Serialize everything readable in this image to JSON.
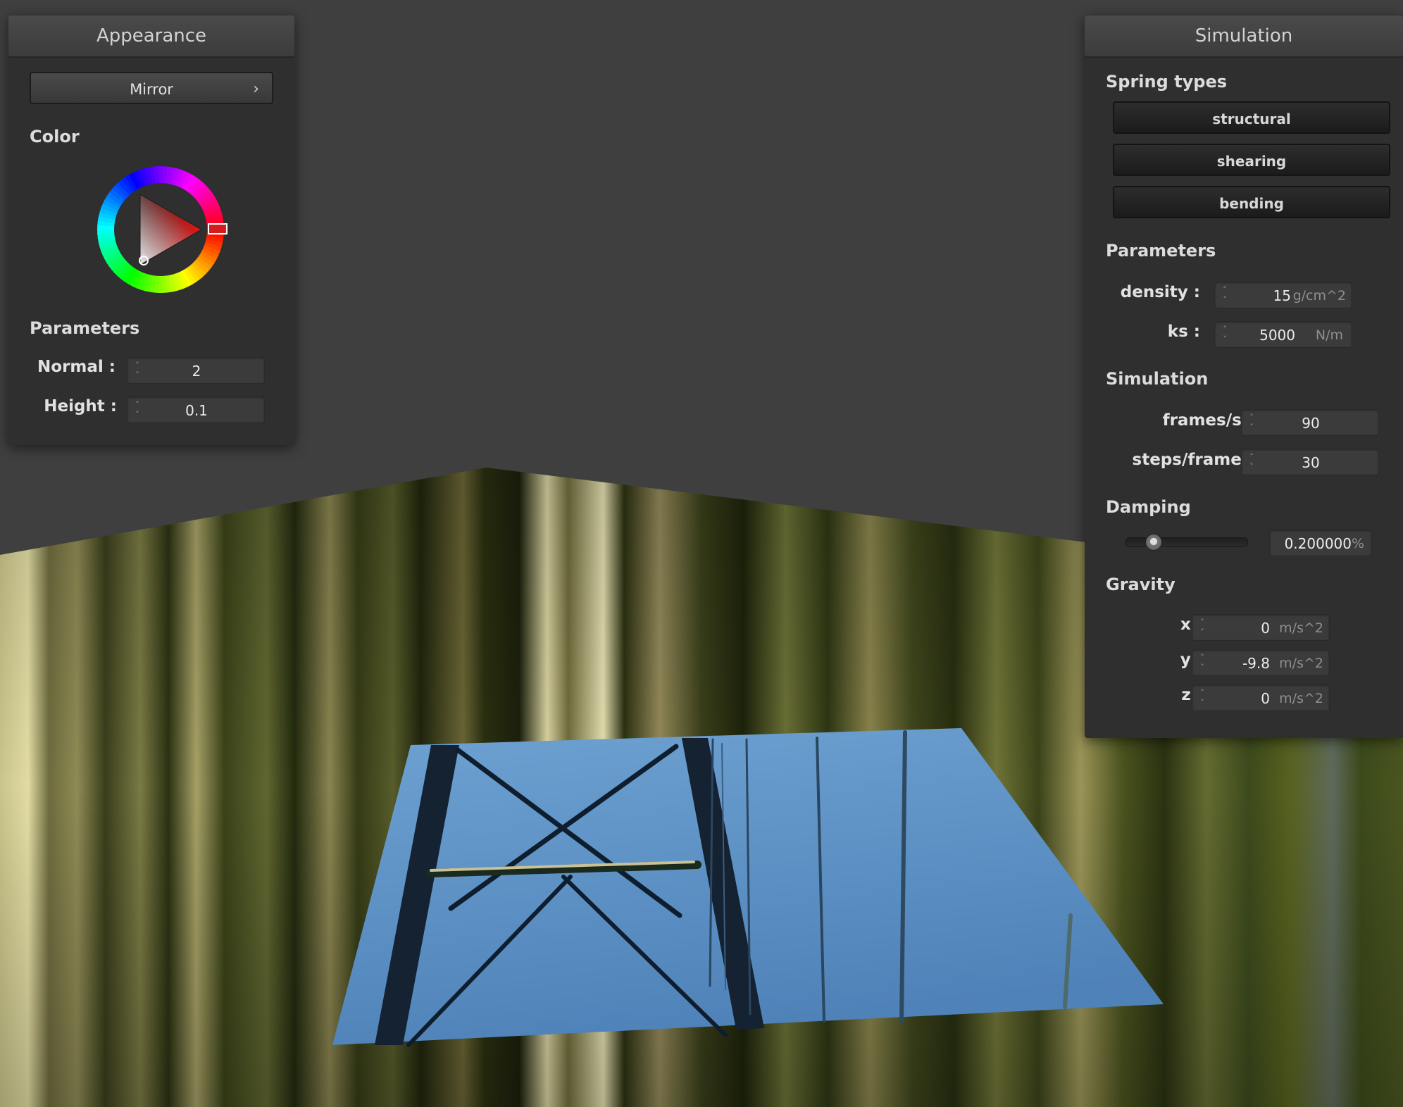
{
  "appearance": {
    "title": "Appearance",
    "shader_button": "Mirror",
    "chevron": "›",
    "color_label": "Color",
    "color_hex": "#d51b1b",
    "parameters_label": "Parameters",
    "normal_label": "Normal :",
    "normal_value": "2",
    "height_label": "Height :",
    "height_value": "0.1"
  },
  "simulation": {
    "title": "Simulation",
    "spring_types_label": "Spring types",
    "spring_types": [
      "structural",
      "shearing",
      "bending"
    ],
    "parameters_label": "Parameters",
    "density_label": "density :",
    "density_value": "15",
    "density_unit": "g/cm^2",
    "ks_label": "ks :",
    "ks_value": "5000",
    "ks_unit": "N/m",
    "simulation_label": "Simulation",
    "fps_label": "frames/s :",
    "fps_value": "90",
    "steps_label": "steps/frame :",
    "steps_value": "30",
    "damping_label": "Damping",
    "damping_value": "0.200000",
    "damping_unit": "%",
    "damping_fraction": 0.2,
    "gravity_label": "Gravity",
    "gravity": [
      {
        "label": "x :",
        "value": "0",
        "unit": "m/s^2"
      },
      {
        "label": "y :",
        "value": "-9.8",
        "unit": "m/s^2"
      },
      {
        "label": "z :",
        "value": "0",
        "unit": "m/s^2"
      }
    ]
  },
  "spinner_glyphs": {
    "up": "˄",
    "down": "˅"
  },
  "colors": {
    "background": "#3f3f3f",
    "panel": "#2f2f2f",
    "cloth_sky": "#5f96c7",
    "wall_dark": "#2f3512",
    "wall_light": "#d4cc8a"
  }
}
